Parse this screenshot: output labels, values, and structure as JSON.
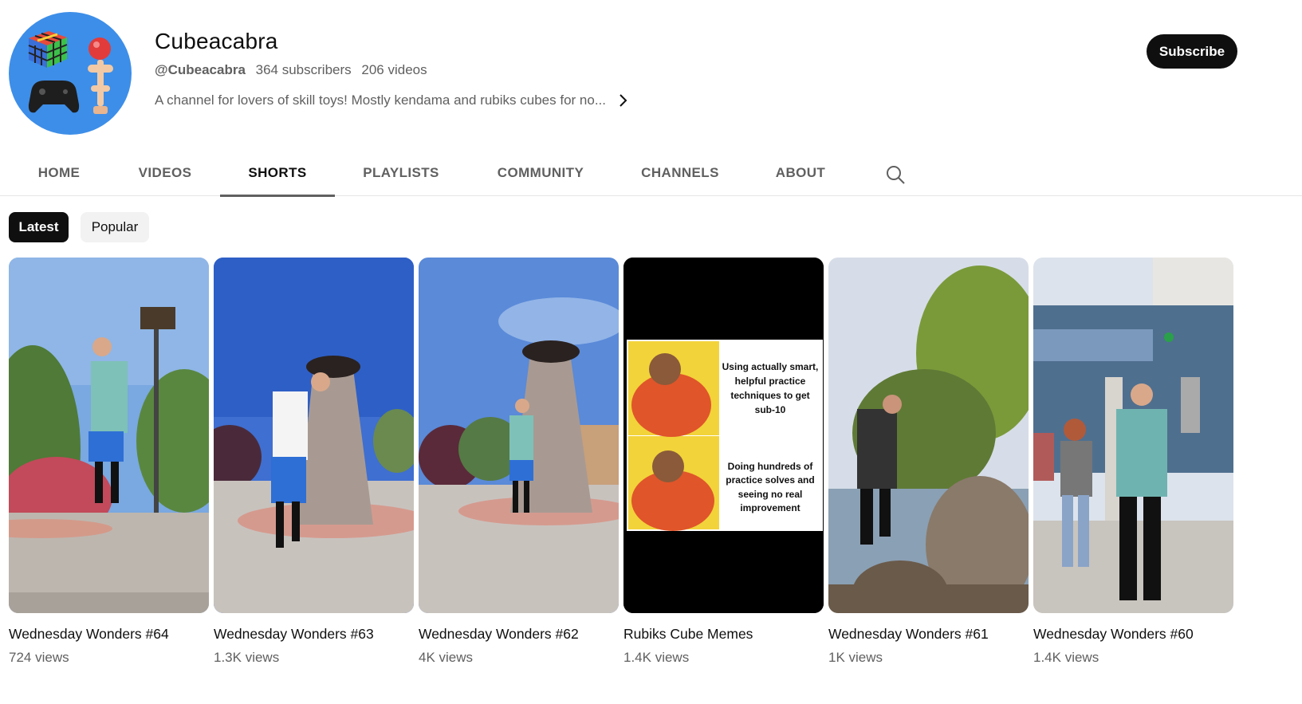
{
  "channel": {
    "name": "Cubeacabra",
    "handle": "@Cubeacabra",
    "subscribers": "364 subscribers",
    "videos": "206 videos",
    "description": "A channel for lovers of skill toys! Mostly kendama and rubiks cubes for no...",
    "subscribe_label": "Subscribe",
    "avatar_color": "#3d8ee8"
  },
  "tabs": [
    {
      "label": "HOME"
    },
    {
      "label": "VIDEOS"
    },
    {
      "label": "SHORTS",
      "active": true
    },
    {
      "label": "PLAYLISTS"
    },
    {
      "label": "COMMUNITY"
    },
    {
      "label": "CHANNELS"
    },
    {
      "label": "ABOUT"
    }
  ],
  "chips": {
    "latest": "Latest",
    "popular": "Popular"
  },
  "shorts": [
    {
      "title": "Wednesday Wonders #64",
      "views": "724 views"
    },
    {
      "title": "Wednesday Wonders #63",
      "views": "1.3K views"
    },
    {
      "title": "Wednesday Wonders #62",
      "views": "4K views"
    },
    {
      "title": "Rubiks Cube Memes",
      "views": "1.4K views"
    },
    {
      "title": "Wednesday Wonders #61",
      "views": "1K views"
    },
    {
      "title": "Wednesday Wonders #60",
      "views": "1.4K views"
    }
  ],
  "meme": {
    "top_text": "Using actually smart, helpful practice techniques to get sub-10",
    "bottom_text": "Doing hundreds of practice solves and seeing no real improvement"
  },
  "icons": {
    "search": "search-icon",
    "chevron": "chevron-right-icon"
  }
}
